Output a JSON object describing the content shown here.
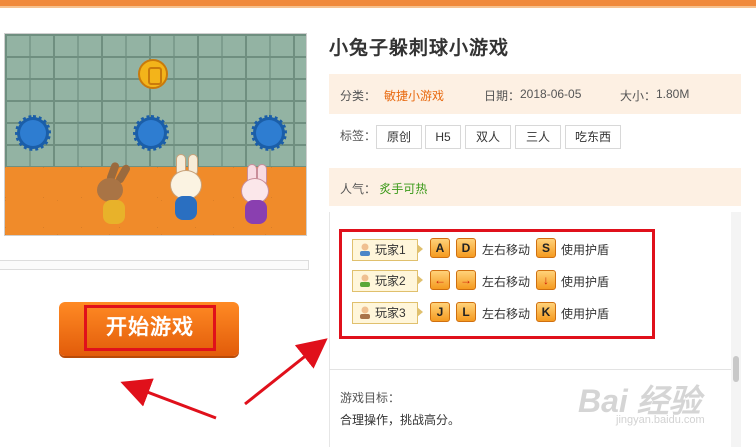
{
  "game": {
    "title": "小兔子躲刺球小游戏",
    "category_label": "分类：",
    "category": "敏捷小游戏",
    "date_label": "日期：",
    "date": "2018-06-05",
    "size_label": "大小：",
    "size": "1.80M",
    "tags_label": "标签：",
    "tags": [
      "原创",
      "H5",
      "双人",
      "三人",
      "吃东西"
    ],
    "popularity_label": "人气：",
    "popularity": "炙手可热"
  },
  "controls": [
    {
      "player": "玩家1",
      "keys": [
        "A",
        "D"
      ],
      "move": "左右移动",
      "shield_key": "S",
      "shield": "使用护盾",
      "icon_color": "#4b86c8"
    },
    {
      "player": "玩家2",
      "keys": [
        "←",
        "→"
      ],
      "move": "左右移动",
      "shield_key": "↓",
      "shield": "使用护盾",
      "icon_color": "#5aa83a"
    },
    {
      "player": "玩家3",
      "keys": [
        "J",
        "L"
      ],
      "move": "左右移动",
      "shield_key": "K",
      "shield": "使用护盾",
      "icon_color": "#a8744a"
    }
  ],
  "goal": {
    "label": "游戏目标：",
    "text": "合理操作，挑战高分。"
  },
  "start_button": "开始游戏",
  "watermark": {
    "big": "Bai 经验",
    "small": "jingyan.baidu.com"
  },
  "colors": {
    "accent": "#f08a3c",
    "highlight_box": "#e0101b",
    "category": "#e86a10",
    "popularity": "#3b9a1a"
  }
}
